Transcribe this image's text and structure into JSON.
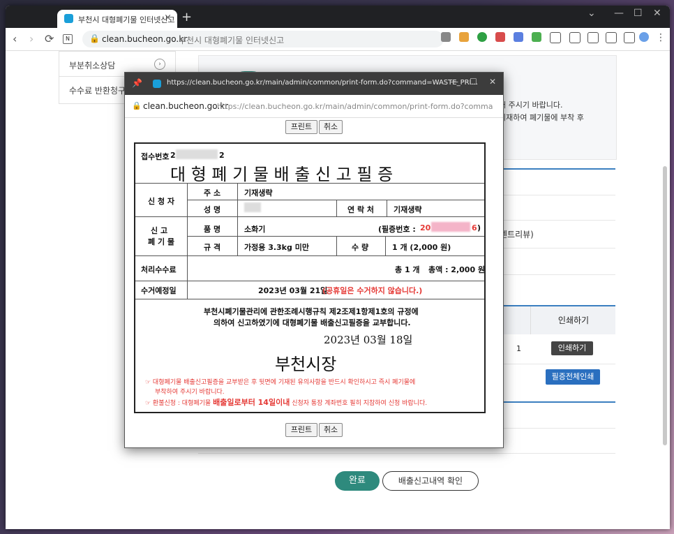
{
  "browser": {
    "tab_title": "부천시 대형폐기물 인터넷신고",
    "host": "clean.bucheon.go.kr",
    "page_title": "부천시 대형폐기물 인터넷신고"
  },
  "sidebar": {
    "items": [
      {
        "label": "부분취소상담"
      },
      {
        "label": "수수료 반환청구"
      }
    ]
  },
  "info": {
    "line1": "해 주시기 바랍니다.",
    "line2": "기재하여 폐기물에 부착 후"
  },
  "page": {
    "row_text": "센트리뷰)",
    "table": {
      "print_header": "인쇄하기",
      "qty": "1",
      "print_btn": "인쇄하기",
      "print_all_btn": "필증전체인쇄"
    },
    "done_btn": "완료",
    "history_btn": "배출신고내역 확인"
  },
  "popup": {
    "title_url": "https://clean.bucheon.go.kr/main/admin/common/print-form.do?command=WASTE_PRI...",
    "host": "clean.bucheon.go.kr",
    "url": "https://clean.bucheon.go.kr/main/admin/common/print-form.do?command=V",
    "print_btn": "프린트",
    "cancel_btn": "취소"
  },
  "cert": {
    "receipt_label": "접수번호",
    "receipt_prefix": "2",
    "receipt_suffix": "2",
    "title": "대 형 폐 기 물 배 출 신 고 필 증",
    "applicant_label": "신 청 자",
    "address_label": "주 소",
    "address_value": "기재생략",
    "name_label": "성 명",
    "contact_label": "연 락 처",
    "contact_value": "기재생략",
    "waste_label_1": "신   고",
    "waste_label_2": "폐 기 물",
    "item_label": "품 명",
    "item_value": "소화기",
    "cert_no_label": "(필증번호 : ",
    "cert_no_prefix": "20",
    "cert_no_suffix": "6",
    "cert_no_close": ")",
    "spec_label": "규 격",
    "spec_value": "가정용 3.3kg 미만",
    "qty_label": "수 량",
    "qty_value": "1 개 (2,000 원)",
    "fee_label": "처리수수료",
    "fee_total": "총 1 개",
    "fee_amount": "총액 : 2,000 원",
    "pickup_label": "수거예정일",
    "pickup_date": "2023년 03월 21일",
    "pickup_note": "(공휴일은 수거하지 않습니다.)",
    "statement_1": "부천시폐기물관리에 관한조례시행규칙 제2조제1항제1호의 규정에",
    "statement_2": "의하여 신고하였기에 대형폐기물 배출신고필증을 교부합니다.",
    "issue_date": "2023년  03월  18일",
    "issuer": "부천시장",
    "notice_1": "☞ 대형폐기물 배출신고필증을 교부받은 후 뒷면에 기재된 유의사항을 반드시 확인하시고 즉시 폐기물에",
    "notice_2": "부착하여 주시기 바랍니다.",
    "notice_3a": "☞ 환불신청 : 대형폐기물",
    "notice_3b": "배출일로부터 14일이내",
    "notice_3c": "신청자 통장 계좌번호 필히 지참하여 신청 바랍니다."
  },
  "colors": {
    "accent_green": "#2e8a7d",
    "accent_blue": "#2a6fbf",
    "notice_red": "#e53935"
  }
}
